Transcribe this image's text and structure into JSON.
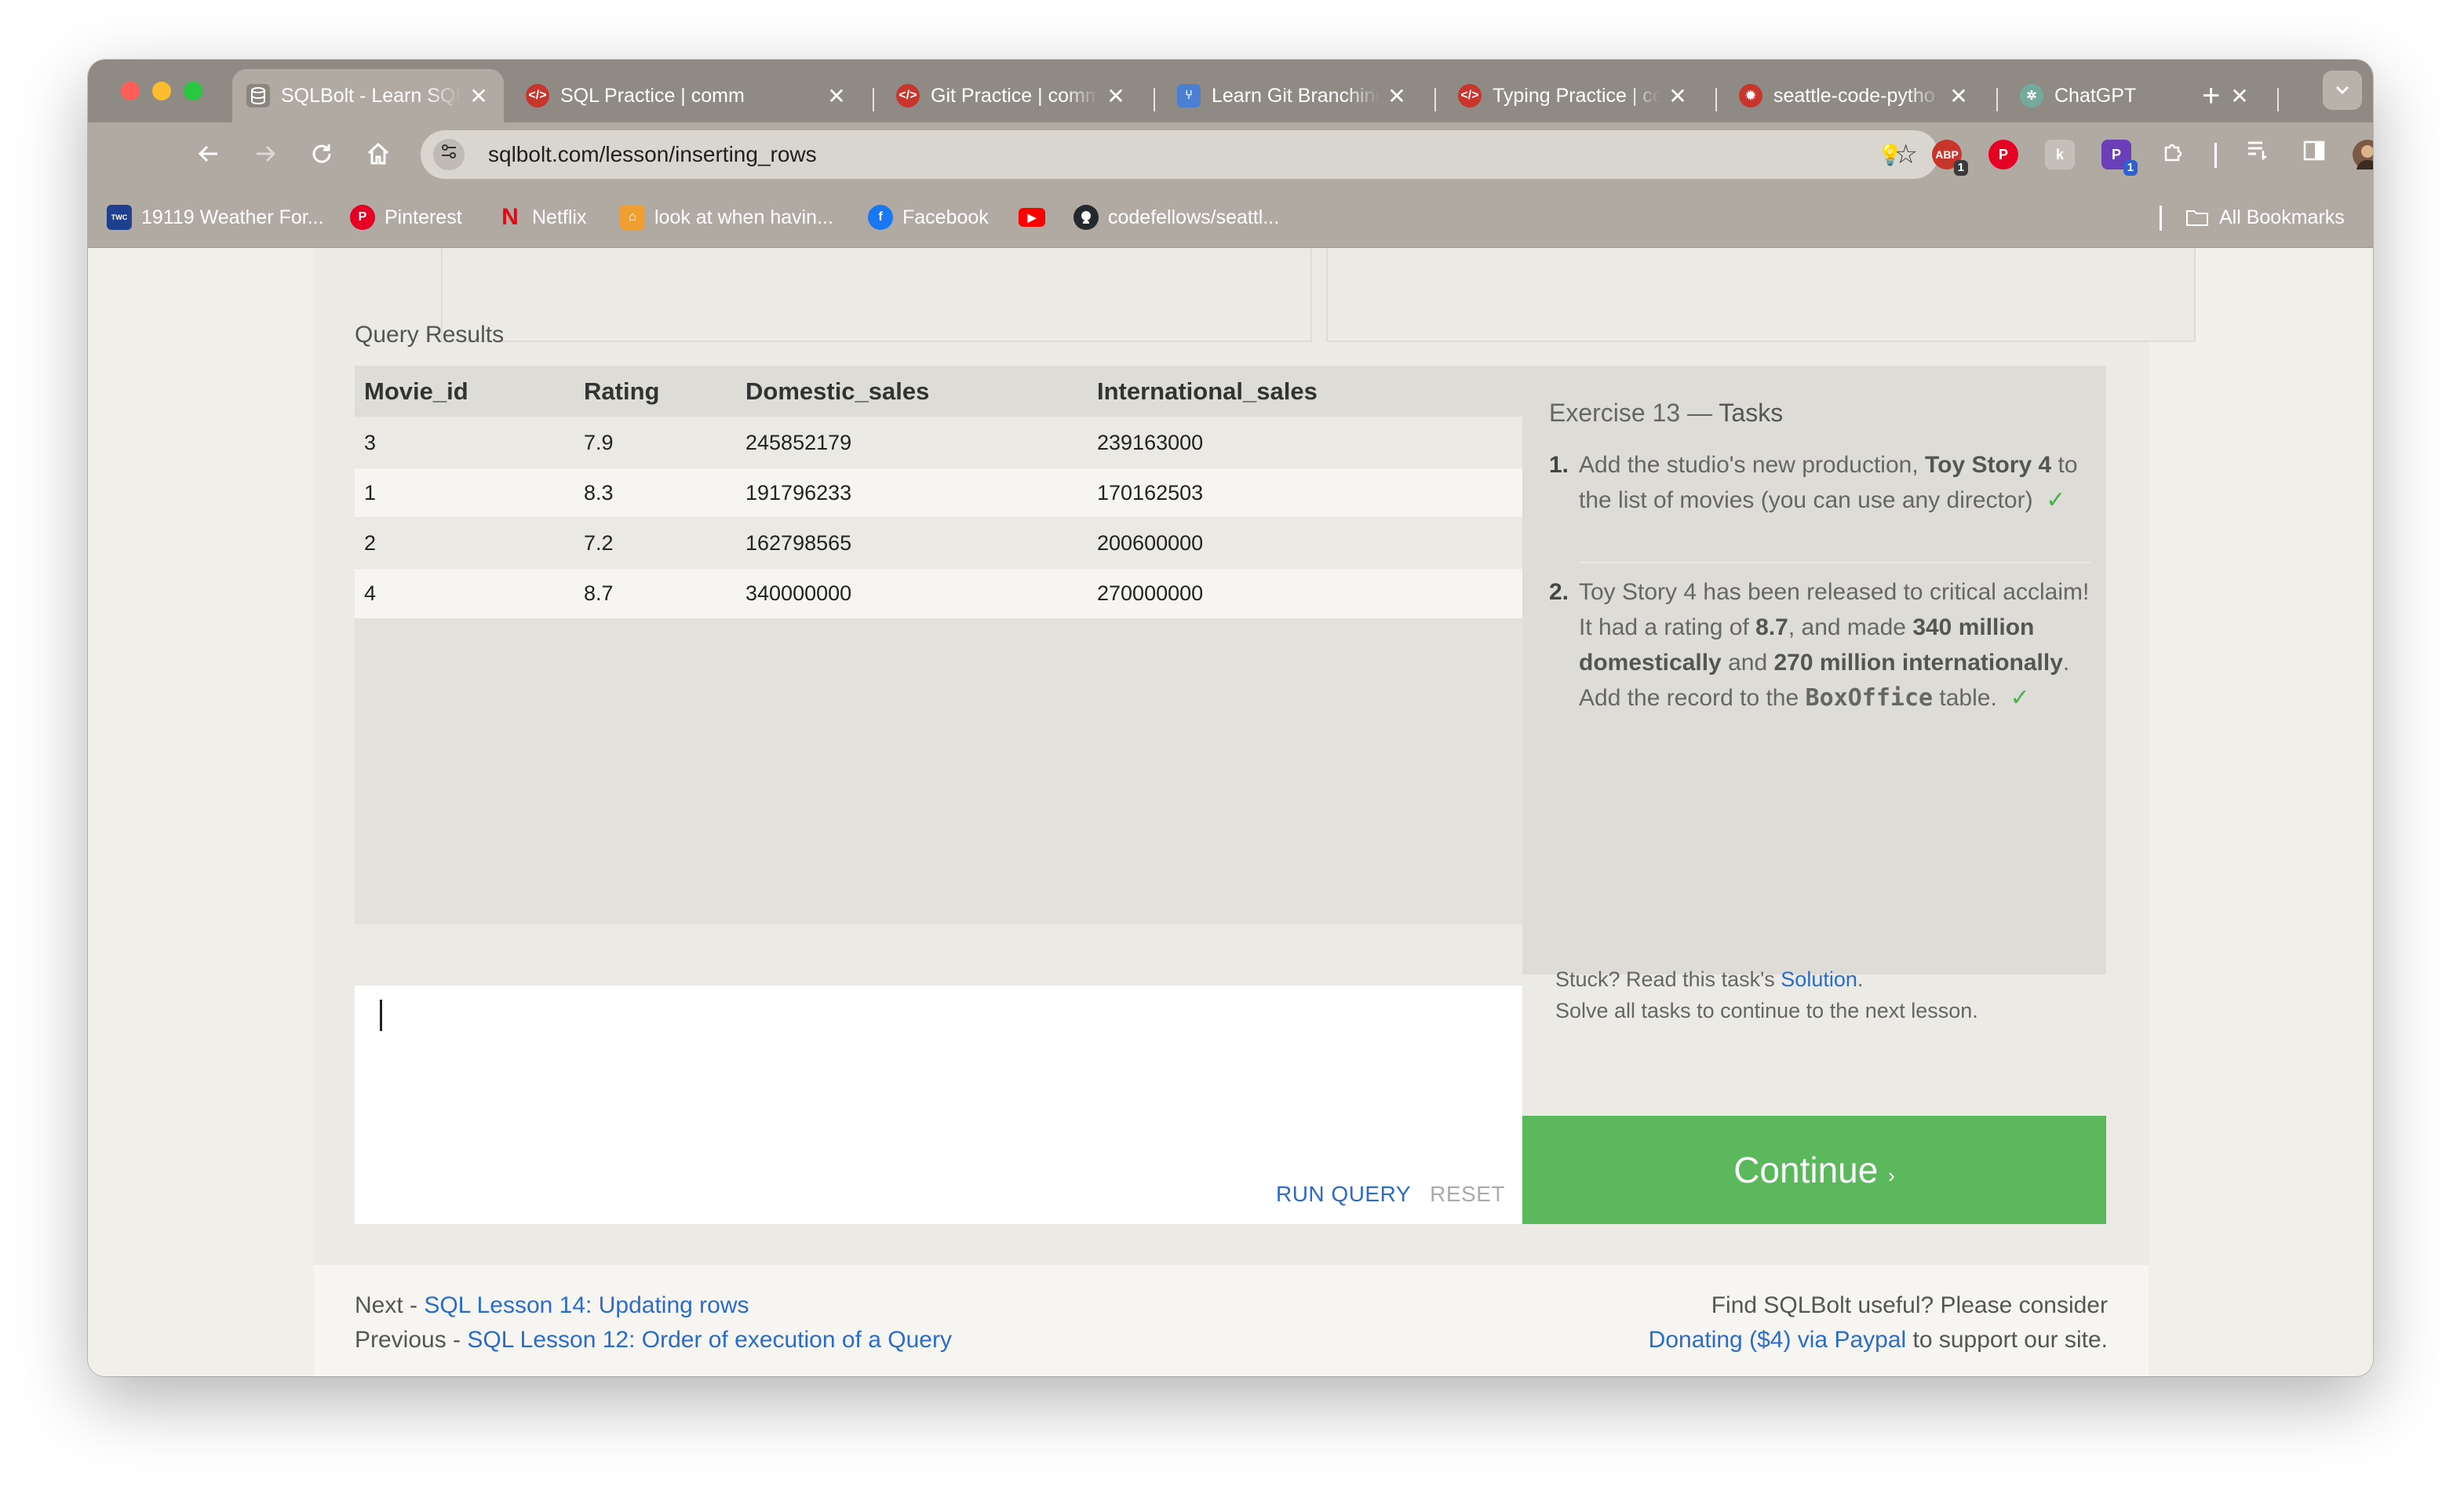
{
  "browser": {
    "tabs": [
      {
        "title": "SQLBolt - Learn SQL",
        "icon": "database-icon",
        "active": true
      },
      {
        "title": "SQL Practice | comm",
        "icon": "codefellows-icon",
        "active": false
      },
      {
        "title": "Git Practice | comm",
        "icon": "codefellows-icon",
        "active": false
      },
      {
        "title": "Learn Git Branching",
        "icon": "git-branching-icon",
        "active": false
      },
      {
        "title": "Typing Practice | co",
        "icon": "codefellows-icon",
        "active": false
      },
      {
        "title": "seattle-code-pytho",
        "icon": "github-gear-icon",
        "active": false
      },
      {
        "title": "ChatGPT",
        "icon": "chatgpt-icon",
        "active": false
      }
    ],
    "close_glyph": "✕",
    "new_tab_glyph": "+",
    "address": "sqlbolt.com/lesson/inserting_rows",
    "extension_badges": [
      "1",
      "1"
    ],
    "bookmarks": [
      {
        "label": "19119 Weather For...",
        "icon": "weather-channel-icon"
      },
      {
        "label": "Pinterest",
        "icon": "pinterest-icon"
      },
      {
        "label": "Netflix",
        "icon": "netflix-icon"
      },
      {
        "label": "look at when havin...",
        "icon": "bookmark-folder-icon"
      },
      {
        "label": "Facebook",
        "icon": "facebook-icon"
      },
      {
        "label": "",
        "icon": "youtube-icon"
      },
      {
        "label": "codefellows/seattl...",
        "icon": "github-icon"
      }
    ],
    "all_bookmarks": "All Bookmarks"
  },
  "query_results": {
    "label": "Query Results",
    "columns": [
      "Movie_id",
      "Rating",
      "Domestic_sales",
      "International_sales"
    ],
    "rows": [
      [
        "3",
        "7.9",
        "245852179",
        "239163000"
      ],
      [
        "1",
        "8.3",
        "191796233",
        "170162503"
      ],
      [
        "2",
        "7.2",
        "162798565",
        "200600000"
      ],
      [
        "4",
        "8.7",
        "340000000",
        "270000000"
      ]
    ]
  },
  "editor": {
    "run_query": "RUN QUERY",
    "reset": "RESET"
  },
  "exercise": {
    "title_prefix": "Exercise 13 — ",
    "title_suffix": "Tasks",
    "task1": {
      "num": "1.",
      "pre": "Add the studio's new production, ",
      "bold": "Toy Story 4",
      "post": " to the list of movies (you can use any director)"
    },
    "task2": {
      "num": "2.",
      "p1": "Toy Story 4 has been released to critical acclaim! It had a rating of ",
      "b1": "8.7",
      "p2": ", and made ",
      "b2": "340 million domestically",
      "p3": " and ",
      "b3": "270 million internationally",
      "p4": ". Add the record to the ",
      "code": "BoxOffice",
      "p5": " table."
    },
    "check": "✓",
    "stuck_pre": "Stuck? Read this task's ",
    "stuck_link": "Solution",
    "stuck_post": ".",
    "solve_all": "Solve all tasks to continue to the next lesson."
  },
  "continue_button": {
    "label": "Continue",
    "arrow": "›"
  },
  "footer": {
    "next_prefix": "Next - ",
    "next_link": "SQL Lesson 14: Updating rows",
    "prev_prefix": "Previous - ",
    "prev_link": "SQL Lesson 12: Order of execution of a Query",
    "support_line1": "Find SQLBolt useful? Please consider",
    "donate_link": "Donating ($4) via Paypal",
    "support_post": " to support our site."
  },
  "colors": {
    "accent_link": "#2a6cc7",
    "continue_green": "#5cb85c",
    "check_green": "#4caf50"
  }
}
